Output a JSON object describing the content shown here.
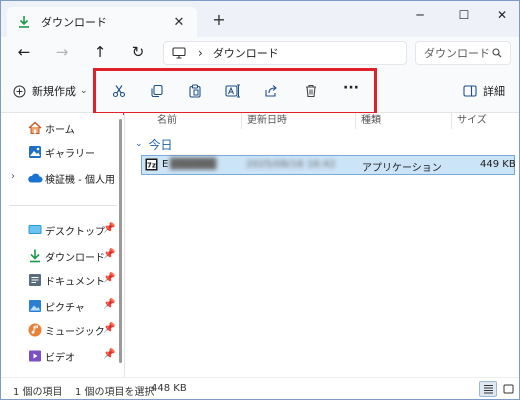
{
  "tab": {
    "title": "ダウンロード",
    "close": "✕",
    "new_tab": "+"
  },
  "window_controls": {
    "minimize": "─",
    "maximize": "☐",
    "close": "✕"
  },
  "nav": {
    "back": "←",
    "forward": "→",
    "up": "↑",
    "refresh": "↻"
  },
  "address": {
    "chevron": "›",
    "location": "ダウンロード"
  },
  "search": {
    "placeholder": "ダウンロード"
  },
  "command_bar": {
    "new_label": "新規作成",
    "new_caret": "⌄",
    "more": "···",
    "details_label": "詳細",
    "icons": [
      "cut-icon",
      "copy-icon",
      "paste-icon",
      "rename-icon",
      "share-icon",
      "delete-icon"
    ]
  },
  "sidebar": {
    "items": [
      {
        "label": "ホーム",
        "icon": "home-icon"
      },
      {
        "label": "ギャラリー",
        "icon": "gallery-icon"
      },
      {
        "label": "検証機 - 個人用",
        "icon": "cloud-icon"
      }
    ],
    "quick_access": [
      {
        "label": "デスクトップ",
        "icon": "desktop-icon"
      },
      {
        "label": "ダウンロード",
        "icon": "download-icon"
      },
      {
        "label": "ドキュメント",
        "icon": "document-icon"
      },
      {
        "label": "ピクチャ",
        "icon": "pictures-icon"
      },
      {
        "label": "ミュージック",
        "icon": "music-icon"
      },
      {
        "label": "ビデオ",
        "icon": "video-icon"
      }
    ],
    "pin": "📌"
  },
  "columns": {
    "name": "名前",
    "modified": "更新日時",
    "type": "種類",
    "size": "サイズ"
  },
  "group": {
    "label": "今日",
    "chevron": "⌄"
  },
  "files": [
    {
      "name": "E",
      "modified": "2025/08/16 16:42",
      "type": "アプリケーション",
      "size": "449 KB",
      "icon": "7zip-icon"
    }
  ],
  "status": {
    "item_count": "1 個の項目",
    "selection": "1 個の項目を選択",
    "selection_size": "448 KB"
  },
  "colors": {
    "accent": "#1d5fa8",
    "selection_bg": "#cce4f7",
    "highlight_box": "#e0202a"
  }
}
